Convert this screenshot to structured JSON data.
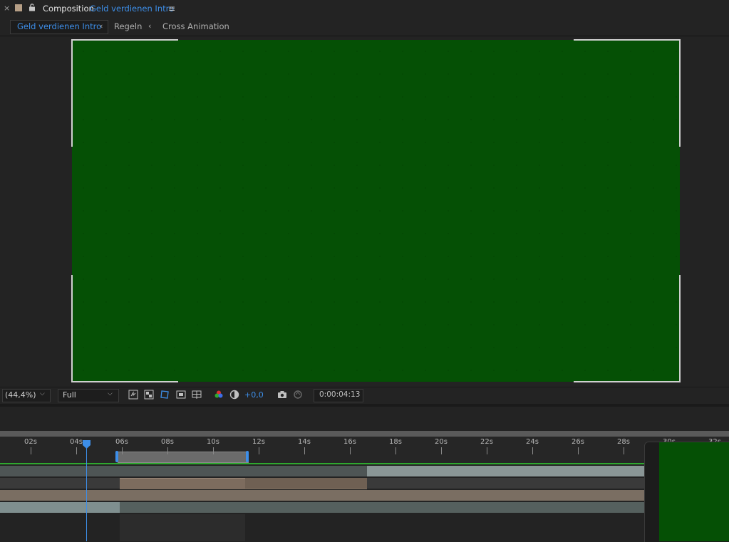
{
  "header": {
    "close_label": "×",
    "comp_word": "Composition",
    "comp_name": "Geld verdienen Intro",
    "menu_glyph": "≡"
  },
  "breadcrumb": {
    "active": "Geld verdienen Intro",
    "items": [
      "Regeln",
      "Cross Animation"
    ],
    "separator": "‹"
  },
  "viewer": {
    "canvas_color": "#055005"
  },
  "viewer_controls": {
    "zoom": "(44,4%)",
    "resolution": "Full",
    "exposure": "+0,0",
    "timecode": "0:00:04:13",
    "icons": [
      "fast-previews-icon",
      "transparency-grid-icon",
      "mask-visibility-icon",
      "region-of-interest-icon",
      "guides-icon",
      "color-channels-icon",
      "exposure-reset-icon",
      "snapshot-icon",
      "show-snapshot-icon"
    ]
  },
  "timeline": {
    "ticks": [
      "02s",
      "04s",
      "06s",
      "08s",
      "10s",
      "12s",
      "14s",
      "16s",
      "18s",
      "20s",
      "22s",
      "24s",
      "26s",
      "28s",
      "30s",
      "32s"
    ],
    "current_time_label": "0:00:04:13",
    "accent_color": "#3d8ee8",
    "work_area_line_color": "#2fa82f"
  }
}
